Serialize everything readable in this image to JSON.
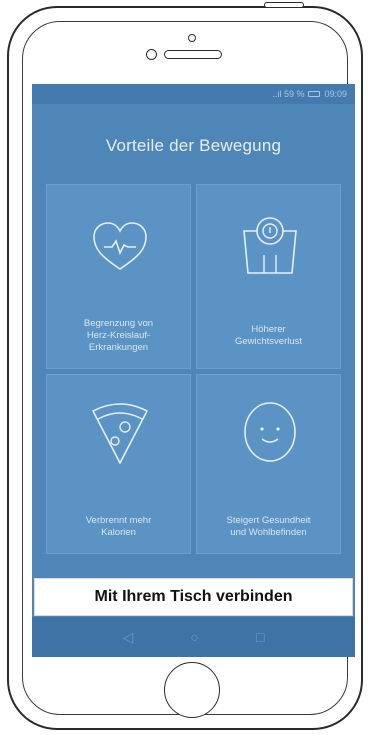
{
  "status_bar": {
    "signal": "..il 59 %",
    "time": "09:09"
  },
  "screen": {
    "title": "Vorteile der Bewegung"
  },
  "tiles": [
    {
      "icon": "heart-pulse-icon",
      "lines": [
        "Begrenzung von",
        "Herz-Kreislauf-",
        "Erkrankungen"
      ]
    },
    {
      "icon": "scale-icon",
      "lines": [
        "Höherer",
        "Gewichtsverlust"
      ]
    },
    {
      "icon": "pizza-slice-icon",
      "lines": [
        "Verbrennt mehr",
        "Kalorien"
      ]
    },
    {
      "icon": "smiley-face-icon",
      "lines": [
        "Steigert Gesundheit",
        "und Wohlbefinden"
      ]
    }
  ],
  "connect_button": {
    "label": "Mit Ihrem Tisch verbinden"
  },
  "nav": {
    "back": "◁",
    "home": "○",
    "recents": "□"
  },
  "colors": {
    "screen_bg": "#4f86b8",
    "tile_bg": "#5a93c4",
    "navbar_bg": "#3f73a5"
  }
}
